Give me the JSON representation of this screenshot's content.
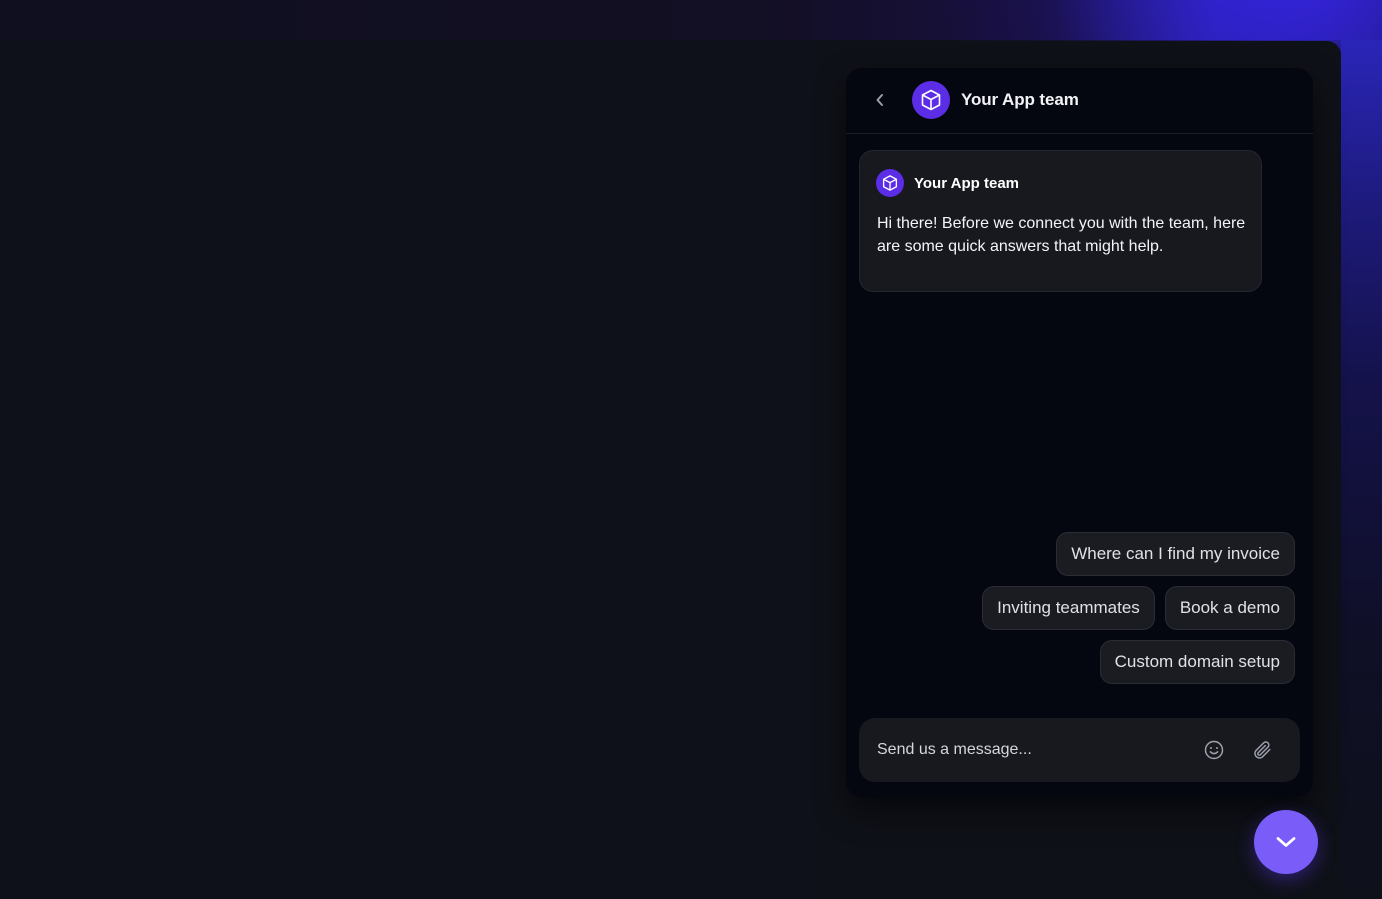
{
  "header": {
    "title": "Your App team",
    "avatar_icon": "cube-icon",
    "back_icon": "chevron-left-icon"
  },
  "message": {
    "sender": "Your App team",
    "avatar_icon": "cube-icon",
    "text": "Hi there! Before we connect you with the team, here are some quick answers that might help."
  },
  "quick_replies": [
    [
      "Where can I find my invoice"
    ],
    [
      "Inviting teammates",
      "Book a demo"
    ],
    [
      "Custom domain setup"
    ]
  ],
  "composer": {
    "placeholder": "Send us a message...",
    "emoji_icon": "smiley-icon",
    "attach_icon": "paperclip-icon"
  },
  "launcher": {
    "icon": "chevron-down-icon"
  },
  "colors": {
    "accent": "#7a5cf8",
    "avatar": "#5b2de6",
    "window_bg": "#050710",
    "card_bg": "#17191f",
    "page_bg": "#0e111a"
  }
}
